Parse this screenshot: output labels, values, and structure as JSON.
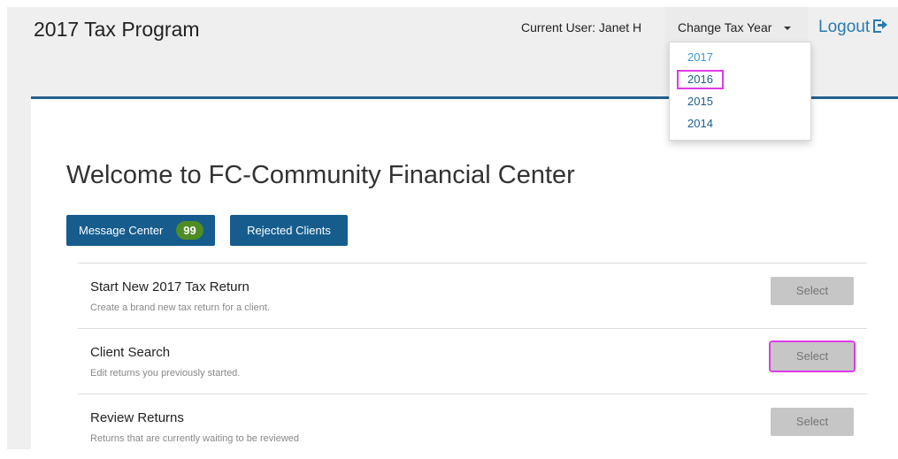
{
  "header": {
    "title": "2017 Tax Program",
    "current_user": "Current User: Janet H",
    "change_year_label": "Change Tax Year",
    "logout_label": "Logout"
  },
  "year_menu": {
    "options": [
      "2017",
      "2016",
      "2015",
      "2014"
    ],
    "highlighted": "2016"
  },
  "main": {
    "welcome": "Welcome to FC-Community Financial Center",
    "message_center_label": "Message Center",
    "message_count": "99",
    "rejected_clients_label": "Rejected Clients",
    "rows": [
      {
        "title": "Start New 2017 Tax Return",
        "desc": "Create a brand new tax return for a client.",
        "button": "Select"
      },
      {
        "title": "Client Search",
        "desc": "Edit returns you previously started.",
        "button": "Select"
      },
      {
        "title": "Review Returns",
        "desc": "Returns that are currently waiting to be reviewed",
        "button": "Select"
      }
    ]
  },
  "colors": {
    "accent": "#165d8e",
    "badge": "#4e8c24",
    "link": "#2a7aaf",
    "highlight": "#e03ae8"
  }
}
